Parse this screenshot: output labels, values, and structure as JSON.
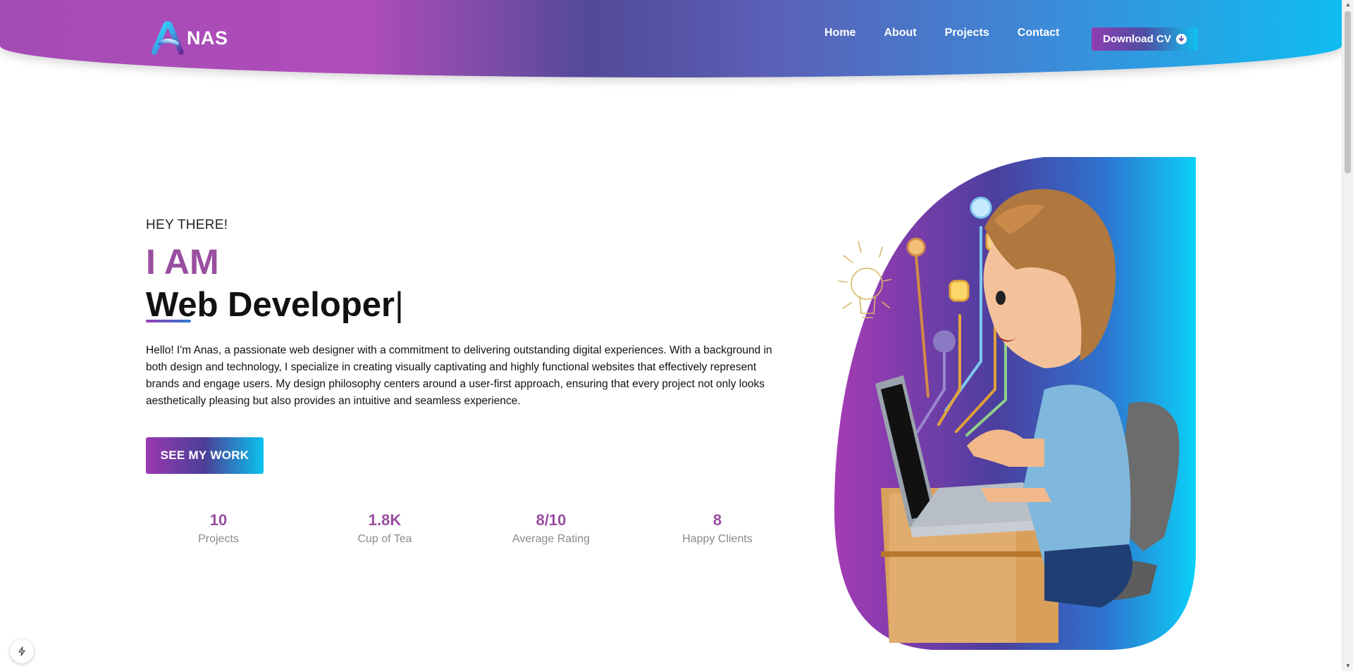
{
  "brand": {
    "logo_text": "NAS"
  },
  "nav": {
    "items": [
      "Home",
      "About",
      "Projects",
      "Contact"
    ],
    "download_label": "Download CV"
  },
  "hero": {
    "greeting": "HEY THERE!",
    "heading": "I AM",
    "role": "Web Developer",
    "cursor": "|",
    "intro": "Hello! I'm Anas, a passionate web designer with a commitment to delivering outstanding digital experiences. With a background in both design and technology, I specialize in creating visually captivating and highly functional websites that effectively represent brands and engage users. My design philosophy centers around a user-first approach, ensuring that every project not only looks aesthetically pleasing but also provides an intuitive and seamless experience.",
    "cta_label": "SEE MY WORK"
  },
  "stats": [
    {
      "value": "10",
      "label": "Projects"
    },
    {
      "value": "1.8K",
      "label": "Cup of Tea"
    },
    {
      "value": "8/10",
      "label": "Average Rating"
    },
    {
      "value": "8",
      "label": "Happy Clients"
    }
  ],
  "colors": {
    "accent": "#9a4ea0",
    "gradient_start": "#a44bb6",
    "gradient_mid": "#524a98",
    "gradient_end": "#0fbdf0"
  },
  "icons": {
    "download": "download-circle-icon",
    "corner": "lightning-icon"
  }
}
